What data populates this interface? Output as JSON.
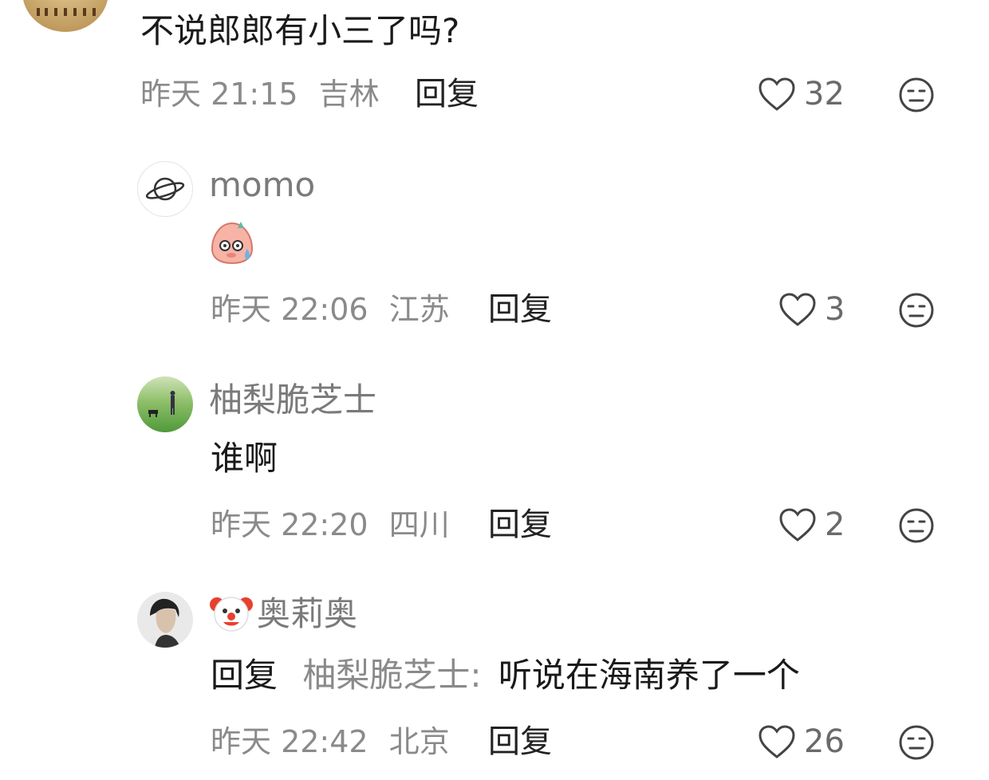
{
  "comments": [
    {
      "text": "不说郎郎有小三了吗?",
      "time": "昨天 21:15",
      "location": "吉林",
      "reply_label": "回复",
      "likes": "32"
    },
    {
      "username": "momo",
      "content_icon": "sweat-pig-emoji",
      "time": "昨天 22:06",
      "location": "江苏",
      "reply_label": "回复",
      "likes": "3"
    },
    {
      "username": "柚梨脆芝士",
      "text": "谁啊",
      "time": "昨天 22:20",
      "location": "四川",
      "reply_label": "回复",
      "likes": "2"
    },
    {
      "username_icon": "clown-emoji",
      "username": "奥莉奥",
      "reply_prefix": "回复",
      "reply_target": "柚梨脆芝士:",
      "text": "听说在海南养了一个",
      "time": "昨天 22:42",
      "location": "北京",
      "reply_label": "回复",
      "likes": "26"
    }
  ],
  "icons": {
    "like": "heart-outline-icon",
    "reaction": "neutral-face-icon"
  }
}
